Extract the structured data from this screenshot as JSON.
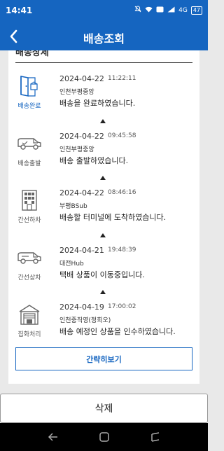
{
  "status_bar": {
    "time": "14:41",
    "signal_text": "4G",
    "battery": "47"
  },
  "app_bar": {
    "title": "배송조회",
    "back_icon": "back-arrow-icon"
  },
  "section": {
    "heading": "배송상세"
  },
  "steps": [
    {
      "icon": "door-delivered-icon",
      "label": "배송완료",
      "date": "2024-04-22",
      "time": "11:22:11",
      "place": "인천부평중앙",
      "message": "배송을 완료하였습니다.",
      "active": true
    },
    {
      "icon": "truck-icon",
      "label": "배송출발",
      "date": "2024-04-22",
      "time": "09:45:58",
      "place": "인천부평중앙",
      "message": "배송 출발하였습니다.",
      "active": false
    },
    {
      "icon": "building-icon",
      "label": "간선하차",
      "date": "2024-04-22",
      "time": "08:46:16",
      "place": "부평BSub",
      "message": "배송할 터미널에 도착하였습니다.",
      "active": false
    },
    {
      "icon": "truck-icon",
      "label": "간선상차",
      "date": "2024-04-21",
      "time": "19:48:39",
      "place": "대전Hub",
      "message": "택배 상품이 이동중입니다.",
      "active": false
    },
    {
      "icon": "warehouse-icon",
      "label": "집화처리",
      "date": "2024-04-19",
      "time": "17:00:02",
      "place": "인천중직영(정희오)",
      "message": "배송 예정인 상품을 인수하였습니다.",
      "active": false
    }
  ],
  "buttons": {
    "collapse": "간략히보기",
    "delete": "삭제"
  },
  "colors": {
    "primary": "#1565c0",
    "background": "#e9e9e9"
  }
}
